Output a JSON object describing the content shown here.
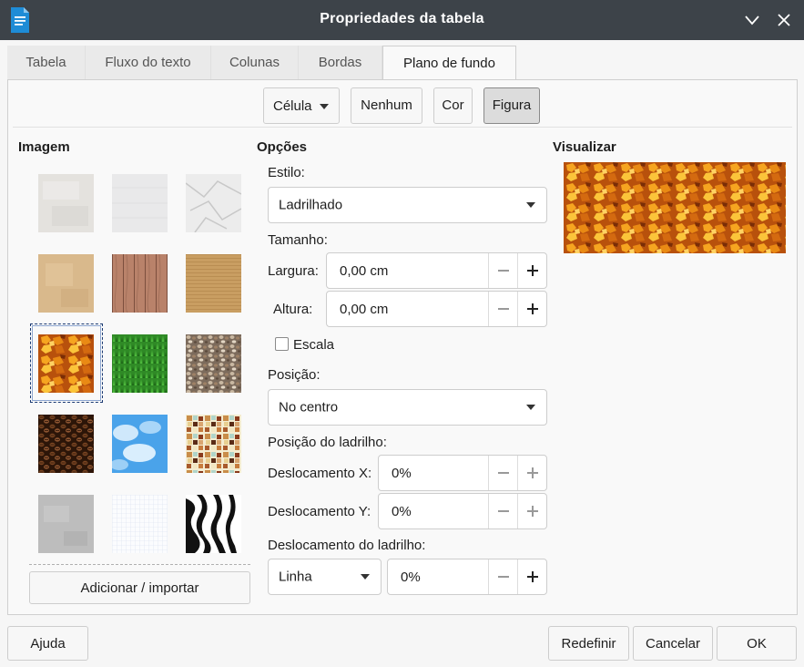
{
  "window": {
    "title": "Propriedades da tabela"
  },
  "tabs": [
    "Tabela",
    "Fluxo do texto",
    "Colunas",
    "Bordas",
    "Plano de fundo"
  ],
  "active_tab": "Plano de fundo",
  "type_selector": {
    "value": "Célula"
  },
  "bg_buttons": {
    "none": "Nenhum",
    "color": "Cor",
    "image": "Figura"
  },
  "image_section": {
    "heading": "Imagem",
    "add_button": "Adicionar / importar",
    "thumbnails": [
      "painted-white",
      "paper-white",
      "paper-crumpled",
      "paper-kraft",
      "wood-planks",
      "cardboard",
      "autumn-leaves",
      "grass",
      "pebbles",
      "coffee-beans",
      "sky-clouds",
      "color-squares",
      "concrete",
      "grid-paper",
      "zebra"
    ],
    "selected": "autumn-leaves"
  },
  "options": {
    "heading": "Opções",
    "style_label": "Estilo:",
    "style_value": "Ladrilhado",
    "size_label": "Tamanho:",
    "width_label": "Largura:",
    "width_value": "0,00 cm",
    "height_label": "Altura:",
    "height_value": "0,00 cm",
    "scale_label": "Escala",
    "scale_checked": false,
    "position_label": "Posição:",
    "position_value": "No centro",
    "tile_position_label": "Posição do ladrilho:",
    "offset_x_label": "Deslocamento X:",
    "offset_x_value": "0%",
    "offset_y_label": "Deslocamento Y:",
    "offset_y_value": "0%",
    "tile_offset_label": "Deslocamento do ladrilho:",
    "tile_offset_mode": "Linha",
    "tile_offset_value": "0%"
  },
  "preview": {
    "heading": "Visualizar"
  },
  "footer": {
    "help": "Ajuda",
    "reset": "Redefinir",
    "cancel": "Cancelar",
    "ok": "OK"
  },
  "colors": {
    "titlebar": "#3d4349",
    "selection": "#1b3a72"
  }
}
